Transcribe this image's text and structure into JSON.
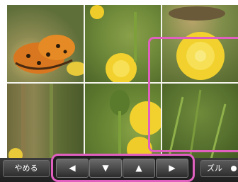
{
  "puzzle": {
    "tiles": [
      {
        "subject": "orange-butterfly"
      },
      {
        "subject": "yellow-dandelion"
      },
      {
        "subject": "butterfly-wing"
      },
      {
        "subject": "green-stems"
      },
      {
        "subject": "dandelion-bud"
      },
      {
        "subject": "grass"
      }
    ]
  },
  "controls": {
    "quit_label": "やめる",
    "left_arrow": "◀",
    "down_arrow": "▼",
    "up_arrow": "▲",
    "right_arrow": "▶",
    "zoom_label": "ズル"
  },
  "colors": {
    "highlight": "#e060c0",
    "bar": "#1f1f1f"
  }
}
